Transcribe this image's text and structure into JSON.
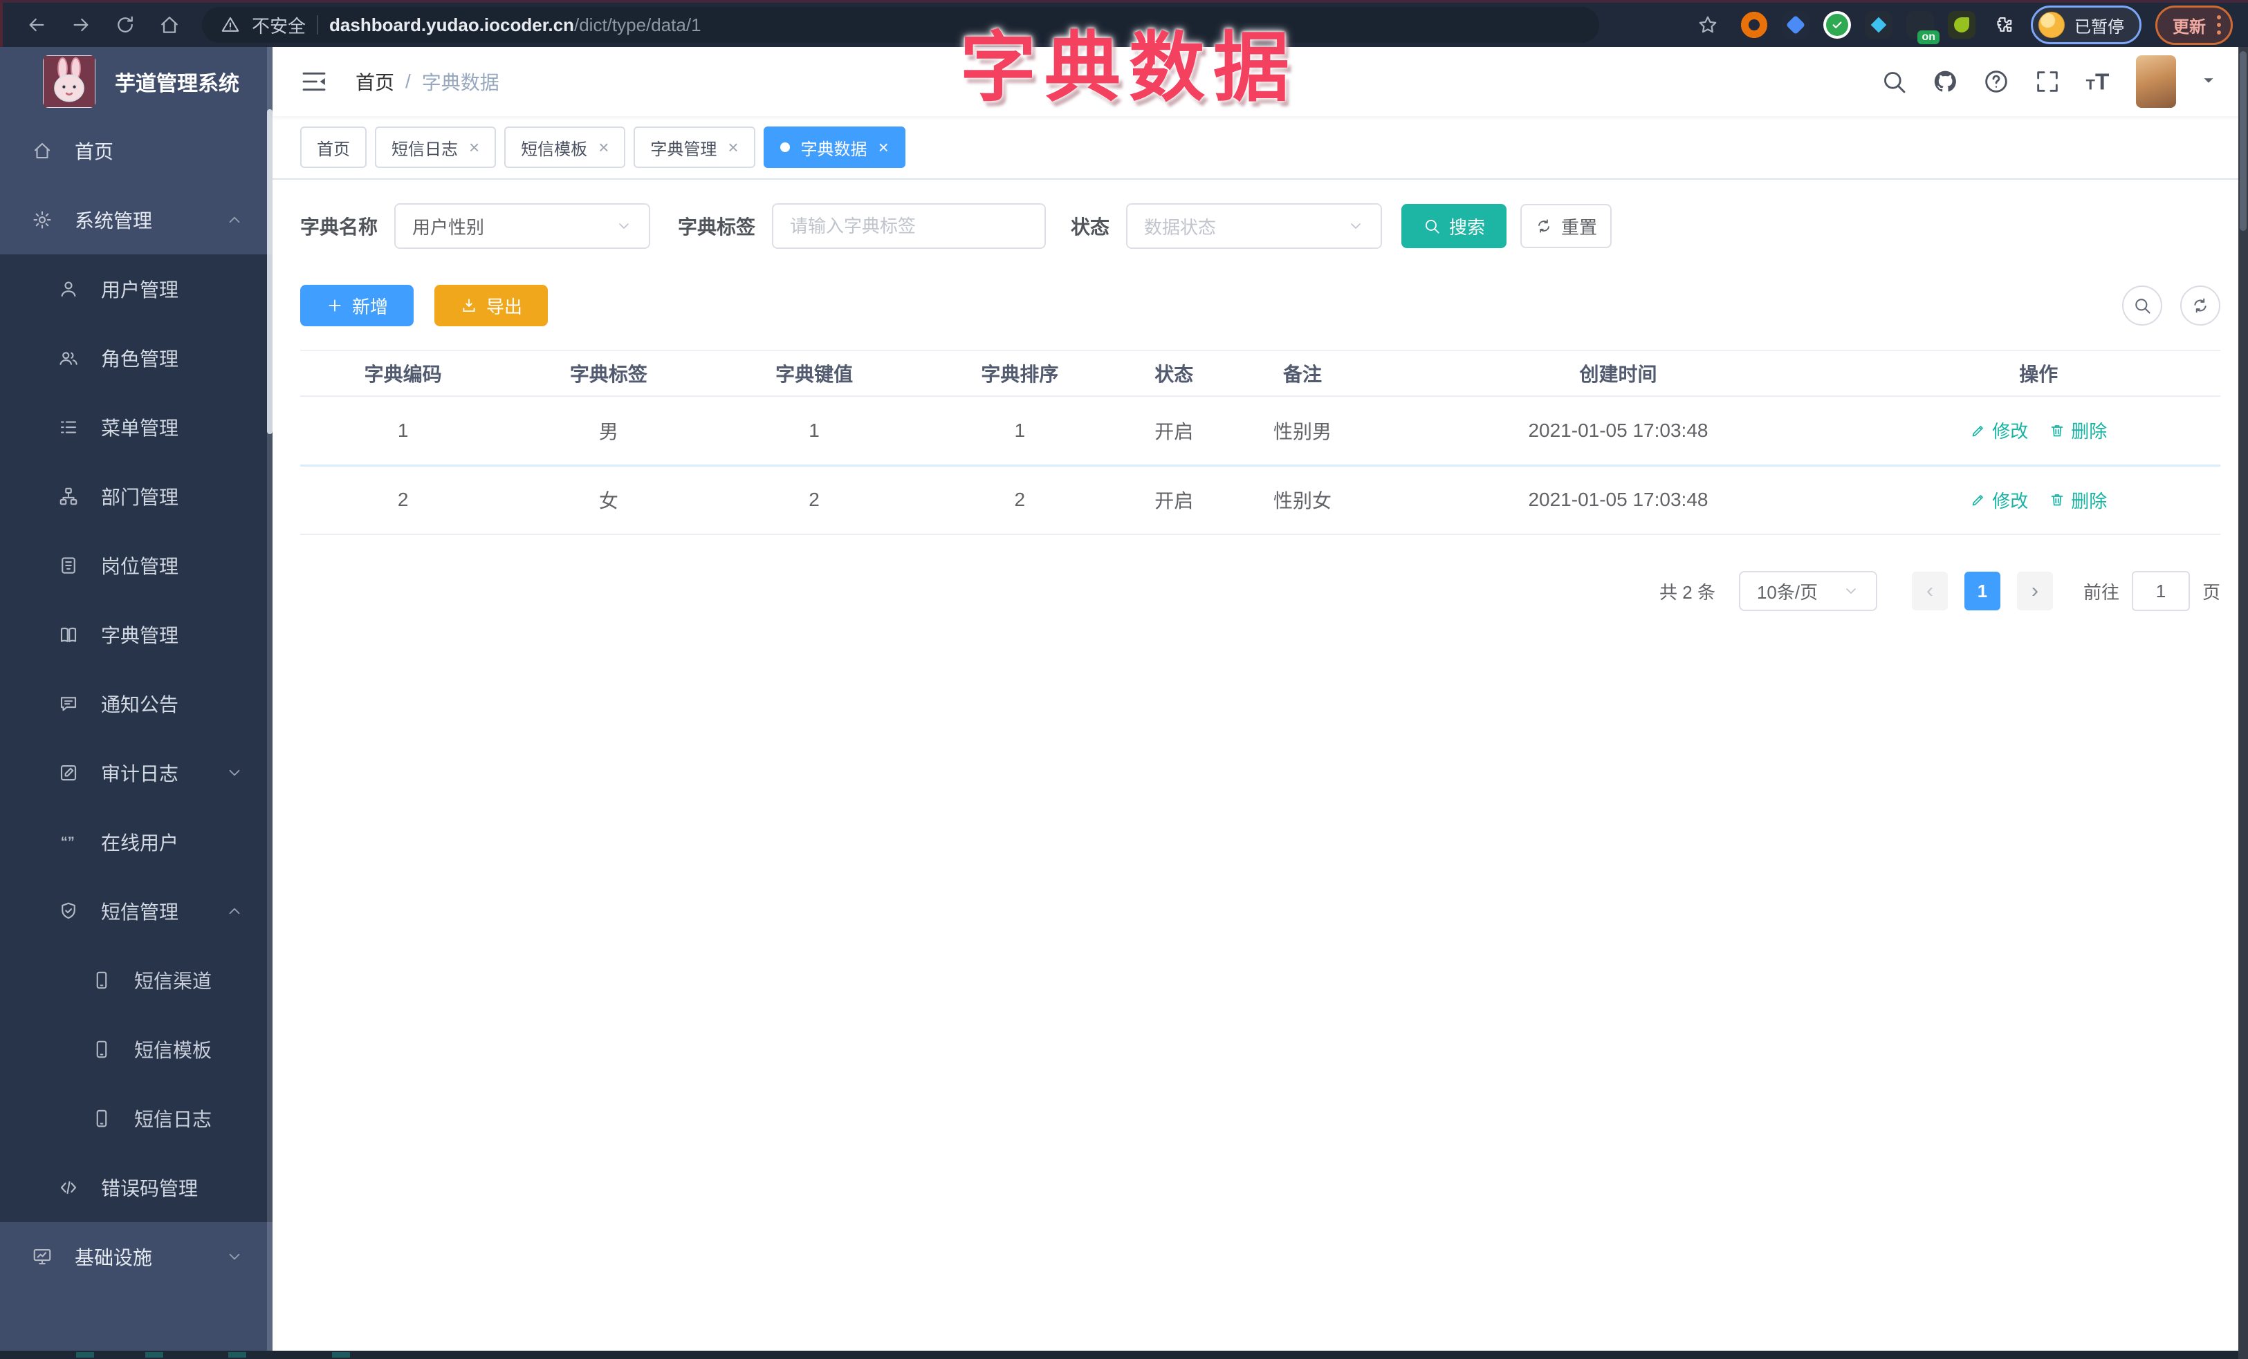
{
  "browser": {
    "security": "不安全",
    "url_domain": "dashboard.yudao.iocoder.cn",
    "url_path": "/dict/type/data/1",
    "ext_badge": "on",
    "paused_label": "已暂停",
    "update_label": "更新"
  },
  "overlay_title": "字典数据",
  "sidebar": {
    "logo_title": "芋道管理系统",
    "items": [
      {
        "label": "首页"
      },
      {
        "label": "系统管理"
      },
      {
        "label": "用户管理"
      },
      {
        "label": "角色管理"
      },
      {
        "label": "菜单管理"
      },
      {
        "label": "部门管理"
      },
      {
        "label": "岗位管理"
      },
      {
        "label": "字典管理"
      },
      {
        "label": "通知公告"
      },
      {
        "label": "审计日志"
      },
      {
        "label": "在线用户"
      },
      {
        "label": "短信管理"
      },
      {
        "label": "短信渠道"
      },
      {
        "label": "短信模板"
      },
      {
        "label": "短信日志"
      },
      {
        "label": "错误码管理"
      },
      {
        "label": "基础设施"
      }
    ]
  },
  "breadcrumb": {
    "home": "首页",
    "sep": "/",
    "current": "字典数据"
  },
  "tabs": [
    {
      "label": "首页"
    },
    {
      "label": "短信日志"
    },
    {
      "label": "短信模板"
    },
    {
      "label": "字典管理"
    },
    {
      "label": "字典数据"
    }
  ],
  "filters": {
    "name_label": "字典名称",
    "name_value": "用户性别",
    "tag_label": "字典标签",
    "tag_placeholder": "请输入字典标签",
    "status_label": "状态",
    "status_placeholder": "数据状态",
    "search_label": "搜索",
    "reset_label": "重置"
  },
  "toolbar": {
    "add_label": "新增",
    "export_label": "导出"
  },
  "table": {
    "columns": [
      "字典编码",
      "字典标签",
      "字典键值",
      "字典排序",
      "状态",
      "备注",
      "创建时间",
      "操作"
    ],
    "rows": [
      {
        "code": "1",
        "label": "男",
        "value": "1",
        "sort": "1",
        "status": "开启",
        "remark": "性别男",
        "created": "2021-01-05 17:03:48"
      },
      {
        "code": "2",
        "label": "女",
        "value": "2",
        "sort": "2",
        "status": "开启",
        "remark": "性别女",
        "created": "2021-01-05 17:03:48"
      }
    ],
    "edit_label": "修改",
    "delete_label": "删除"
  },
  "pagination": {
    "total": "共 2 条",
    "size": "10条/页",
    "page": "1",
    "goto_label": "前往",
    "goto_value": "1",
    "unit": "页"
  },
  "colors": {
    "accent": "#409eff",
    "teal": "#17b3a3",
    "warning": "#f0a71c",
    "overlay_pink": "#f4415f"
  }
}
